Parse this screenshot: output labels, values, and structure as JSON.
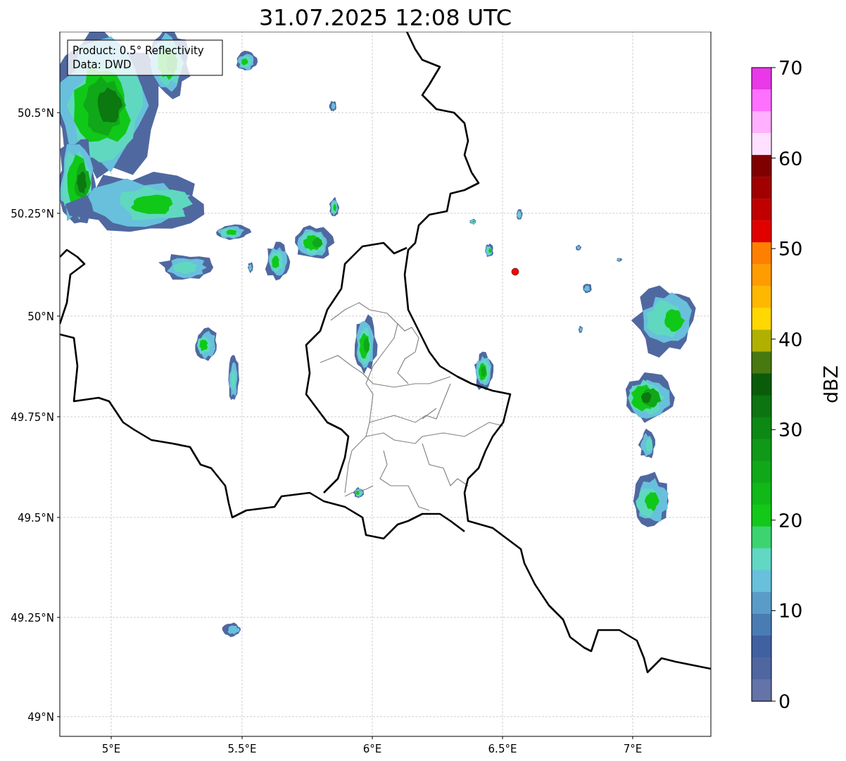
{
  "title": "31.07.2025 12:08 UTC",
  "legend": {
    "lines": [
      "Product: 0.5° Reflectivity",
      "Data: DWD"
    ]
  },
  "x_ticks": [
    "5°E",
    "5.5°E",
    "6°E",
    "6.5°E",
    "7°E"
  ],
  "y_ticks": [
    "50.5°N",
    "50.25°N",
    "50°N",
    "49.75°N",
    "49.5°N",
    "49.25°N",
    "49°N"
  ],
  "colorbar": {
    "label": "dBZ",
    "ticks": [
      "70",
      "60",
      "50",
      "40",
      "30",
      "20",
      "10",
      "0"
    ],
    "segments": [
      {
        "color": "#e838e8"
      },
      {
        "color": "#ff70ff"
      },
      {
        "color": "#ffb0ff"
      },
      {
        "color": "#ffe0ff"
      },
      {
        "color": "#800000"
      },
      {
        "color": "#a00000"
      },
      {
        "color": "#c00000"
      },
      {
        "color": "#e00000"
      },
      {
        "color": "#ff8000"
      },
      {
        "color": "#ff9c00"
      },
      {
        "color": "#ffb800"
      },
      {
        "color": "#ffd800"
      },
      {
        "color": "#b0b000"
      },
      {
        "color": "#487810"
      },
      {
        "color": "#0a5c0a"
      },
      {
        "color": "#0c7410"
      },
      {
        "color": "#0c8814"
      },
      {
        "color": "#109818"
      },
      {
        "color": "#10a818"
      },
      {
        "color": "#10b818"
      },
      {
        "color": "#12c818"
      },
      {
        "color": "#3cd470"
      },
      {
        "color": "#60d8c4"
      },
      {
        "color": "#68c0dc"
      },
      {
        "color": "#5a9cc8"
      },
      {
        "color": "#4a7cb4"
      },
      {
        "color": "#4060a0"
      },
      {
        "color": "#5066a0"
      },
      {
        "color": "#6474a8"
      }
    ]
  }
}
